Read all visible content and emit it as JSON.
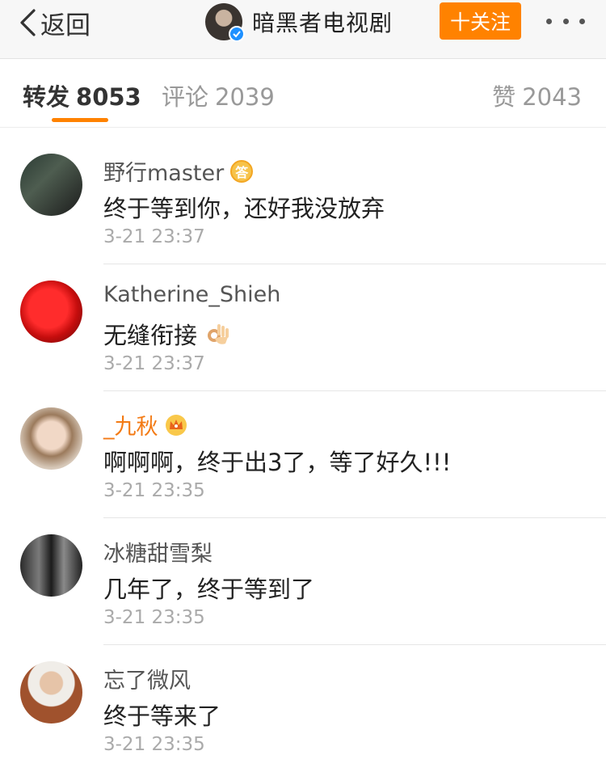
{
  "header": {
    "back_label": "返回",
    "title": "暗黑者电视剧",
    "follow_label": "十关注"
  },
  "tabs": {
    "repost": {
      "label": "转发",
      "count": "8053"
    },
    "comment": {
      "label": "评论",
      "count": "2039"
    },
    "like": {
      "label": "赞",
      "count": "2043"
    }
  },
  "colors": {
    "accent": "#ff8200",
    "verified": "#1e90ff",
    "vip_name": "#f37a14"
  },
  "reposts": [
    {
      "name": "野行master",
      "badge": "answer-badge",
      "text": "终于等到你，还好我没放弃",
      "time": "3-21 23:37"
    },
    {
      "name": "Katherine_Shieh",
      "text": "无缝衔接",
      "emoji": "ok-hand-icon",
      "time": "3-21 23:37"
    },
    {
      "name": "_九秋",
      "badge": "crown-badge",
      "vip": true,
      "text": "啊啊啊，终于出3了，等了好久!!!",
      "time": "3-21 23:35"
    },
    {
      "name": "冰糖甜雪梨",
      "text": "几年了，终于等到了",
      "time": "3-21 23:35"
    },
    {
      "name": "忘了微风",
      "text": "终于等来了",
      "time": "3-21 23:35"
    }
  ]
}
